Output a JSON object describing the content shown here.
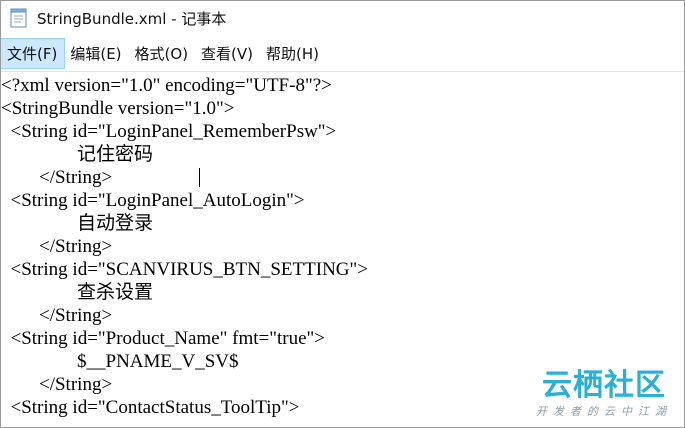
{
  "window": {
    "title": "StringBundle.xml - 记事本",
    "icon": "notepad-icon"
  },
  "menu": [
    {
      "label": "文件(F)",
      "active": true
    },
    {
      "label": "编辑(E)"
    },
    {
      "label": "格式(O)"
    },
    {
      "label": "查看(V)"
    },
    {
      "label": "帮助(H)"
    }
  ],
  "editor": {
    "lines": [
      "<?xml version=\"1.0\" encoding=\"UTF-8\"?>",
      "<StringBundle version=\"1.0\">",
      "  <String id=\"LoginPanel_RememberPsw\">",
      "                记住密码",
      "        </String>",
      "  <String id=\"LoginPanel_AutoLogin\">",
      "                自动登录",
      "        </String>",
      "  <String id=\"SCANVIRUS_BTN_SETTING\">",
      "                查杀设置",
      "        </String>",
      "  <String id=\"Product_Name\" fmt=\"true\">",
      "                $__PNAME_V_SV$",
      "        </String>",
      "  <String id=\"ContactStatus_ToolTip\">"
    ]
  },
  "watermark": {
    "logo": "云栖社区",
    "subtitle": "开发者的云中江湖",
    "color": "#27b1d8"
  }
}
